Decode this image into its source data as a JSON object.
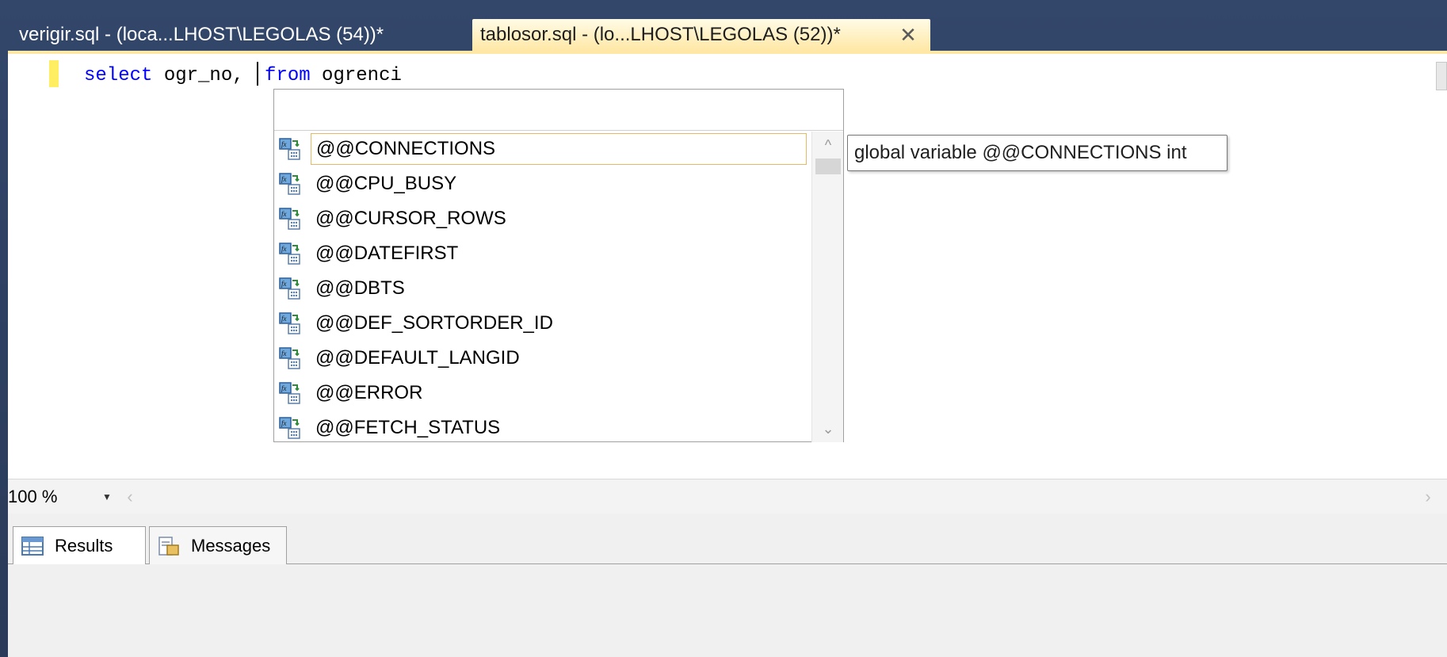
{
  "tabs": [
    {
      "label": "verigir.sql - (loca...LHOST\\LEGOLAS (54))*",
      "active": false
    },
    {
      "label": "tablosor.sql - (lo...LHOST\\LEGOLAS (52))*",
      "active": true
    }
  ],
  "tab_close_glyph": "✕",
  "editor": {
    "code_keyword_1": "select",
    "code_text_1": " ogr_no, ",
    "code_keyword_2": "from",
    "code_text_2": " ogrenci"
  },
  "completion": {
    "filter_value": "",
    "items": [
      {
        "label": "@@CONNECTIONS",
        "icon": "global-variable-icon",
        "selected": true
      },
      {
        "label": "@@CPU_BUSY",
        "icon": "global-variable-icon",
        "selected": false
      },
      {
        "label": "@@CURSOR_ROWS",
        "icon": "global-variable-icon",
        "selected": false
      },
      {
        "label": "@@DATEFIRST",
        "icon": "global-variable-icon",
        "selected": false
      },
      {
        "label": "@@DBTS",
        "icon": "global-variable-icon",
        "selected": false
      },
      {
        "label": "@@DEF_SORTORDER_ID",
        "icon": "global-variable-icon",
        "selected": false
      },
      {
        "label": "@@DEFAULT_LANGID",
        "icon": "global-variable-icon",
        "selected": false
      },
      {
        "label": "@@ERROR",
        "icon": "global-variable-icon",
        "selected": false
      },
      {
        "label": "@@FETCH_STATUS",
        "icon": "global-variable-icon",
        "selected": false
      }
    ],
    "scroll_up_glyph": "^",
    "scroll_down_glyph": "⌄"
  },
  "tooltip": {
    "text": "global variable @@CONNECTIONS int"
  },
  "zoom": {
    "value": "100 %",
    "dropdown_glyph": "▼",
    "scroll_left_glyph": "‹",
    "scroll_right_glyph": "›"
  },
  "result_tabs": [
    {
      "label": "Results",
      "icon": "grid-icon"
    },
    {
      "label": "Messages",
      "icon": "messages-icon"
    }
  ],
  "colors": {
    "keyword": "#0000ff",
    "active_tab": "#ffe8a6",
    "change_marker": "#ffee62",
    "selection_border": "#e6b86a",
    "frame_background": "#2c3d5b"
  }
}
